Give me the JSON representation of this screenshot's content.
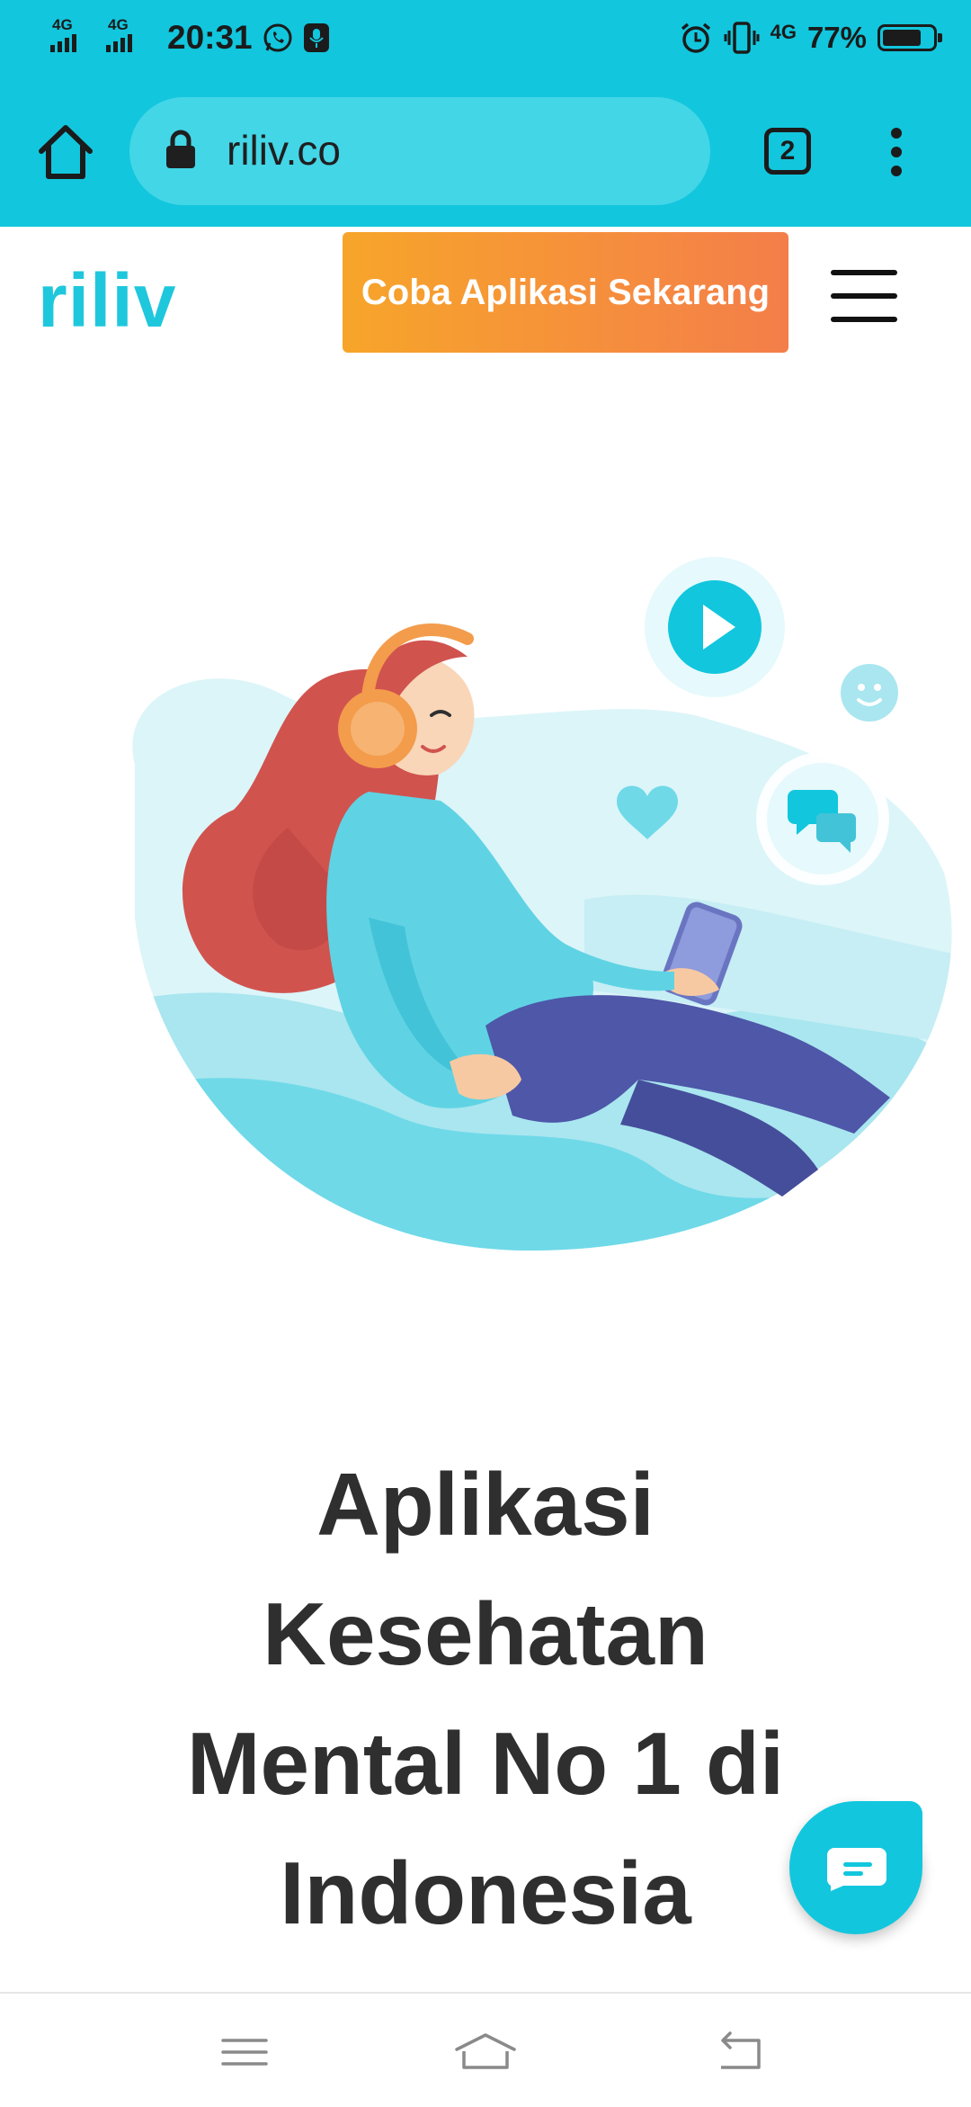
{
  "status_bar": {
    "network_1": "4G",
    "network_2": "4G",
    "time": "20:31",
    "network_3": "4G",
    "battery_percent": "77%",
    "battery_level": 0.77,
    "icons": [
      "whatsapp-icon",
      "mic-icon",
      "alarm-icon",
      "vibrate-icon",
      "battery-icon"
    ]
  },
  "browser": {
    "url": "riliv.co",
    "tab_count": "2"
  },
  "site_header": {
    "logo": "riliv",
    "cta_label": "Coba Aplikasi Sekarang"
  },
  "hero": {
    "headline_line1": "Aplikasi",
    "headline_line2": "Kesehatan",
    "headline_line3": "Mental No 1 di",
    "headline_line4": "Indonesia"
  },
  "colors": {
    "brand_cyan": "#12C6DD",
    "cta_orange_start": "#F7A52A",
    "cta_orange_end": "#F47E4A",
    "headline": "#2F2F2F"
  }
}
